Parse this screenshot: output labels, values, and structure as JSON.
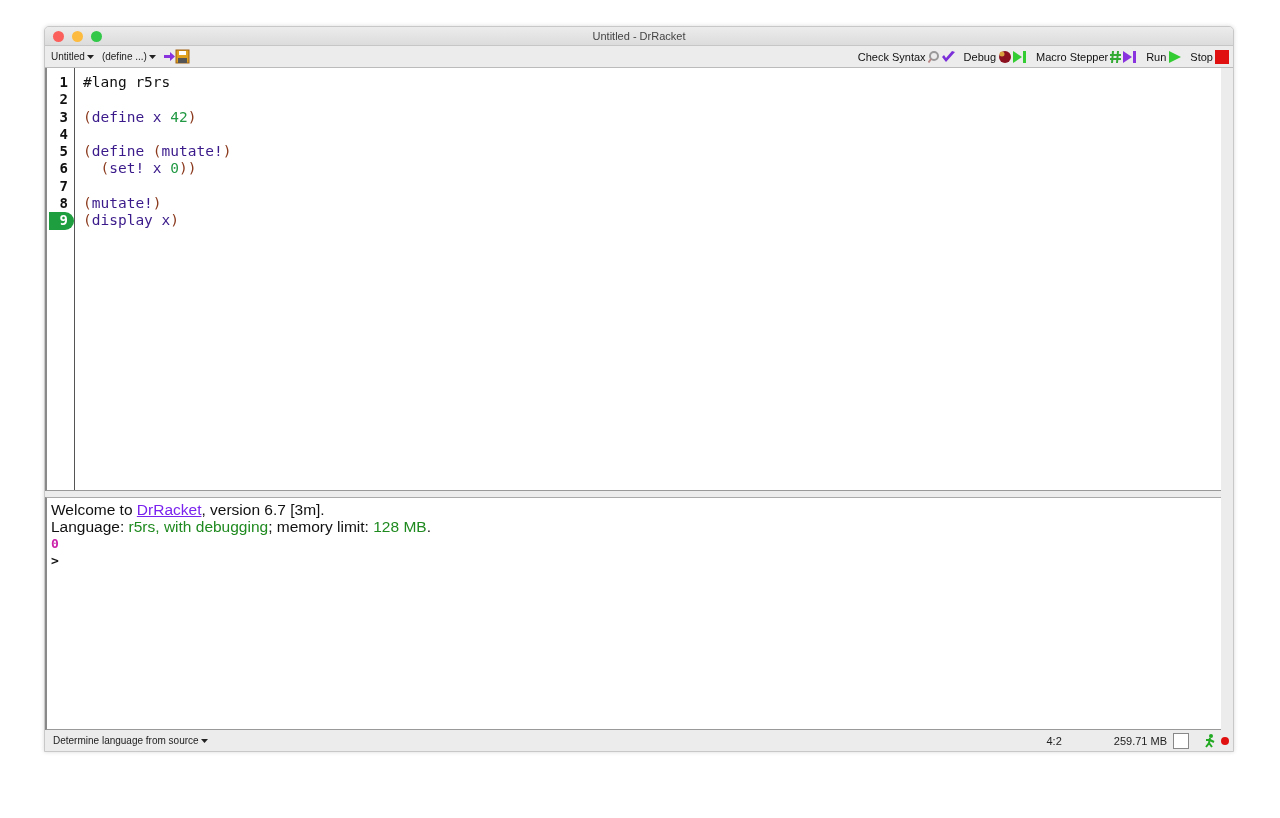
{
  "window": {
    "title": "Untitled - DrRacket"
  },
  "toolbar": {
    "file_menu": "Untitled",
    "define_menu": "(define ...)",
    "buttons": [
      {
        "label": "Check Syntax",
        "kind": "check"
      },
      {
        "label": "Debug",
        "kind": "debug"
      },
      {
        "label": "Macro Stepper",
        "kind": "macro"
      },
      {
        "label": "Run",
        "kind": "run"
      },
      {
        "label": "Stop",
        "kind": "stop"
      }
    ]
  },
  "editor": {
    "lines": [
      {
        "number": "1",
        "current": false,
        "tokens": [
          {
            "text": "#lang r5rs",
            "kind": "plain"
          }
        ]
      },
      {
        "number": "2",
        "current": false
      },
      {
        "number": "3",
        "current": false,
        "tokens": [
          {
            "text": "(",
            "kind": "paren"
          },
          {
            "text": "define x ",
            "kind": "symbol"
          },
          {
            "text": "42",
            "kind": "constant"
          },
          {
            "text": ")",
            "kind": "paren"
          }
        ]
      },
      {
        "number": "4",
        "current": false
      },
      {
        "number": "5",
        "current": false,
        "tokens": [
          {
            "text": "(",
            "kind": "paren"
          },
          {
            "text": "define ",
            "kind": "symbol"
          },
          {
            "text": "(",
            "kind": "paren"
          },
          {
            "text": "mutate!",
            "kind": "symbol"
          },
          {
            "text": ")",
            "kind": "paren"
          }
        ]
      },
      {
        "number": "6",
        "current": false,
        "tokens": [
          {
            "text": "  (",
            "kind": "paren"
          },
          {
            "text": "set! x ",
            "kind": "symbol"
          },
          {
            "text": "0",
            "kind": "constant"
          },
          {
            "text": "))",
            "kind": "paren"
          }
        ]
      },
      {
        "number": "7",
        "current": false
      },
      {
        "number": "8",
        "current": false,
        "tokens": [
          {
            "text": "(",
            "kind": "paren"
          },
          {
            "text": "mutate!",
            "kind": "symbol"
          },
          {
            "text": ")",
            "kind": "paren"
          }
        ]
      },
      {
        "number": "9",
        "current": true,
        "tokens": [
          {
            "text": "(",
            "kind": "paren"
          },
          {
            "text": "display x",
            "kind": "symbol"
          },
          {
            "text": ")",
            "kind": "paren"
          }
        ]
      }
    ]
  },
  "interactions": {
    "lines": [
      {
        "kind": "text",
        "segments": [
          {
            "text": "Welcome to ",
            "kind": "plain"
          },
          {
            "text": "DrRacket",
            "kind": "link"
          },
          {
            "text": ", version 6.7 [3m].",
            "kind": "plain"
          }
        ]
      },
      {
        "kind": "text",
        "segments": [
          {
            "text": "Language: ",
            "kind": "plain"
          },
          {
            "text": "r5rs, with debugging",
            "kind": "info"
          },
          {
            "text": "; memory limit: ",
            "kind": "plain"
          },
          {
            "text": "128 MB",
            "kind": "info"
          },
          {
            "text": ".",
            "kind": "plain"
          }
        ]
      },
      {
        "kind": "output",
        "segments": [
          {
            "text": "0",
            "kind": "output"
          }
        ]
      },
      {
        "kind": "prompt",
        "segments": [
          {
            "text": ">",
            "kind": "prompt"
          }
        ]
      }
    ]
  },
  "status_bar": {
    "language": "Determine language from source",
    "position": "4:2",
    "memory": "259.71 MB"
  }
}
